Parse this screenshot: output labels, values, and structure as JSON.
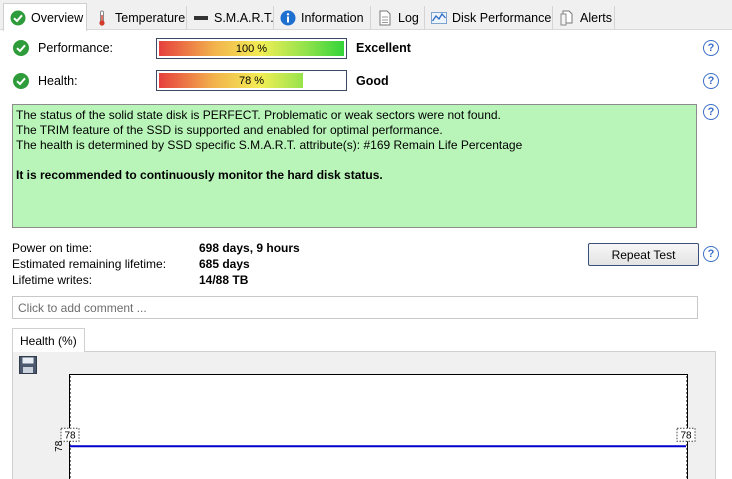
{
  "tabs": [
    {
      "label": "Overview",
      "icon": "green-check-icon",
      "active": true
    },
    {
      "label": "Temperature",
      "icon": "thermometer-icon"
    },
    {
      "label": "S.M.A.R.T.",
      "icon": "smart-bar-icon"
    },
    {
      "label": "Information",
      "icon": "info-icon"
    },
    {
      "label": "Log",
      "icon": "log-document-icon"
    },
    {
      "label": "Disk Performance",
      "icon": "performance-chart-icon"
    },
    {
      "label": "Alerts",
      "icon": "alerts-document-icon"
    }
  ],
  "performance": {
    "label": "Performance:",
    "value": 100,
    "text": "100 %",
    "rating": "Excellent"
  },
  "health": {
    "label": "Health:",
    "value": 78,
    "text": "78 %",
    "rating": "Good"
  },
  "status": {
    "line1": "The status of the solid state disk is PERFECT. Problematic or weak sectors were not found.",
    "line2": "The TRIM feature of the SSD is supported and enabled for optimal performance.",
    "line3": "The health is determined by SSD specific S.M.A.R.T. attribute(s):  #169 Remain Life Percentage",
    "recommendation": "It is recommended to continuously monitor the hard disk status."
  },
  "info": {
    "power_on_label": "Power on time:",
    "power_on_value": "698 days, 9 hours",
    "remaining_label": "Estimated remaining lifetime:",
    "remaining_value": "685 days",
    "writes_label": "Lifetime writes:",
    "writes_value": "14/88 TB"
  },
  "repeat_test_label": "Repeat Test",
  "comment_placeholder": "Click to add comment ...",
  "help_symbol": "?",
  "graph_tab_label": "Health (%)",
  "colors": {
    "status_bg": "#b9f5b9",
    "check_green": "#2e9c3a",
    "help_blue": "#3b6fc8",
    "series_line": "#0000cc"
  },
  "chart_data": {
    "type": "line",
    "series": [
      {
        "values": [
          78,
          78
        ]
      }
    ],
    "point_labels": [
      "78",
      "78"
    ],
    "y_tick_labels": [
      "78"
    ],
    "ylim": [
      50,
      100
    ]
  }
}
